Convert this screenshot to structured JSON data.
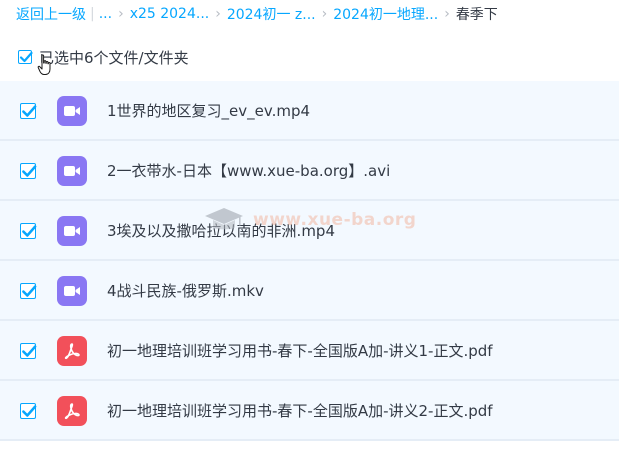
{
  "breadcrumb": {
    "back_label": "返回上一级",
    "ellipsis": "...",
    "items": [
      "x25 2024...",
      "2024初一 z...",
      "2024初一地理..."
    ],
    "current": "春季下"
  },
  "selection": {
    "label": "已选中6个文件/文件夹",
    "checked": true
  },
  "files": [
    {
      "name": "1世界的地区复习_ev_ev.mp4",
      "type": "video",
      "checked": true
    },
    {
      "name": "2一衣带水-日本【www.xue-ba.org】.avi",
      "type": "video",
      "checked": true
    },
    {
      "name": "3埃及以及撒哈拉以南的非洲.mp4",
      "type": "video",
      "checked": true
    },
    {
      "name": "4战斗民族-俄罗斯.mkv",
      "type": "video",
      "checked": true
    },
    {
      "name": "初一地理培训班学习用书-春下-全国版A加-讲义1-正文.pdf",
      "type": "pdf",
      "checked": true
    },
    {
      "name": "初一地理培训班学习用书-春下-全国版A加-讲义2-正文.pdf",
      "type": "pdf",
      "checked": true
    }
  ],
  "watermark": {
    "text": "www.xue-ba.org",
    "icon": "graduation-cap-icon"
  },
  "colors": {
    "accent": "#06a7ff",
    "video_icon": "#8a77f3",
    "pdf_icon": "#f2505a",
    "row_background": "#f3f9ff"
  }
}
